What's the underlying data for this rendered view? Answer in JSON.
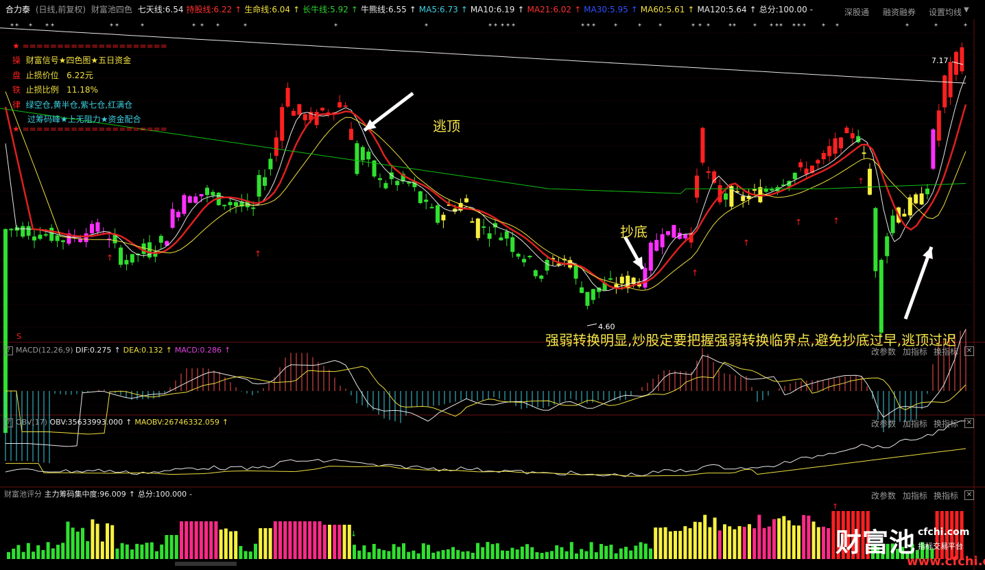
{
  "header": {
    "stock_name": "合力泰",
    "mode": "(日线,前复权)",
    "indicator_name": "财富池四色",
    "lines": [
      {
        "label": "七天线:6.54",
        "color": "#e8e8e8"
      },
      {
        "label": "持股线:6.22",
        "color": "#ff3030"
      },
      {
        "label": "↑",
        "color": "#ff3030"
      },
      {
        "label": "生命线:6.04",
        "color": "#f0e040"
      },
      {
        "label": "↑",
        "color": "#f0e040"
      },
      {
        "label": "长牛线:5.92",
        "color": "#30d030"
      },
      {
        "label": "↑",
        "color": "#30d030"
      },
      {
        "label": "牛熊线:6.55",
        "color": "#e8e8e8"
      },
      {
        "label": "↑",
        "color": "#e8e8e8"
      },
      {
        "label": "MA5:6.73",
        "color": "#3cd0e0"
      },
      {
        "label": "↑",
        "color": "#3cd0e0"
      },
      {
        "label": "MA10:6.19",
        "color": "#e8e8e8"
      },
      {
        "label": "↑",
        "color": "#e8e8e8"
      },
      {
        "label": "MA21:6.02",
        "color": "#ff3030"
      },
      {
        "label": "↑",
        "color": "#ff3030"
      },
      {
        "label": "MA30:5.95",
        "color": "#3050ff"
      },
      {
        "label": "↑",
        "color": "#3050ff"
      },
      {
        "label": "MA60:5.61",
        "color": "#f0e040"
      },
      {
        "label": "↑",
        "color": "#f0e040"
      },
      {
        "label": "MA120:5.64",
        "color": "#e8e8e8"
      },
      {
        "label": "↑",
        "color": "#e8e8e8"
      },
      {
        "label": "总分:100.00",
        "color": "#e8e8e8"
      },
      {
        "label": "-",
        "color": "#e8e8e8"
      }
    ],
    "buttons": [
      "深股通",
      "融资融券",
      "设置均线"
    ]
  },
  "signal_box": {
    "divider": "=====================",
    "rows": [
      {
        "tag": "操",
        "text": "财富信号★四色图★五日资金",
        "value": ""
      },
      {
        "tag": "盘",
        "text": "止损价位",
        "value": "6.22元"
      },
      {
        "tag": "铁",
        "text": "止损比例",
        "value": "11.18%"
      },
      {
        "tag": "律",
        "text": "绿空仓,黄半仓,紫七仓,红满仓",
        "value": ""
      },
      {
        "tag": "",
        "text": "过筹码峰★上无阻力★资金配合",
        "value": ""
      }
    ]
  },
  "annotations": {
    "top": "逃顶",
    "bottom_buy": "抄底",
    "summary": "强弱转换明显,炒股定要把握强弱转换临界点,避免抄底过早,逃顶过迟",
    "high_label": "7.17",
    "low_label": "4.60",
    "s_mark": "S"
  },
  "macd_panel": {
    "title": "MACD(12,26,9)",
    "values": [
      {
        "label": "DIF:0.275",
        "color": "#e8e8e8"
      },
      {
        "label": "↑",
        "color": "#e8e8e8"
      },
      {
        "label": "DEA:0.132",
        "color": "#f0e040"
      },
      {
        "label": "↑",
        "color": "#f0e040"
      },
      {
        "label": "MACD:0.286",
        "color": "#e040e0"
      },
      {
        "label": "↑",
        "color": "#e040e0"
      }
    ],
    "buttons": [
      "改参数",
      "加指标",
      "换指标"
    ]
  },
  "obv_panel": {
    "title": "OBV(17)",
    "values": [
      {
        "label": "OBV:35633993.000",
        "color": "#e8e8e8"
      },
      {
        "label": "↑",
        "color": "#e8e8e8"
      },
      {
        "label": "MAOBV:26746332.059",
        "color": "#f0e040"
      },
      {
        "label": "↑",
        "color": "#f0e040"
      }
    ],
    "buttons": [
      "改参数",
      "加指标",
      "换指标"
    ]
  },
  "score_panel": {
    "title": "财富池评分",
    "values": [
      {
        "label": "主力筹码集中度:96.009",
        "color": "#e8e8e8"
      },
      {
        "label": "↑",
        "color": "#e8e8e8"
      },
      {
        "label": "总分:100.000",
        "color": "#e8e8e8"
      },
      {
        "label": "-",
        "color": "#e8e8e8"
      }
    ],
    "buttons": [
      "改参数",
      "加指标",
      "换指标"
    ]
  },
  "watermark": {
    "brand": "财富池",
    "site": "cfchi.com",
    "slogan": "指标交易平台",
    "url": "www.cfchi.com"
  },
  "colors": {
    "green": "#30e030",
    "yellow": "#f8f040",
    "magenta": "#ff30ff",
    "red": "#ff2020",
    "ma_red": "#e02020",
    "ma_green": "#10c010",
    "bar_pink": "#ff2a88"
  },
  "chart_data": {
    "type": "candlestick",
    "price_range": [
      4.4,
      7.3
    ],
    "high": 7.17,
    "low": 4.6
  }
}
